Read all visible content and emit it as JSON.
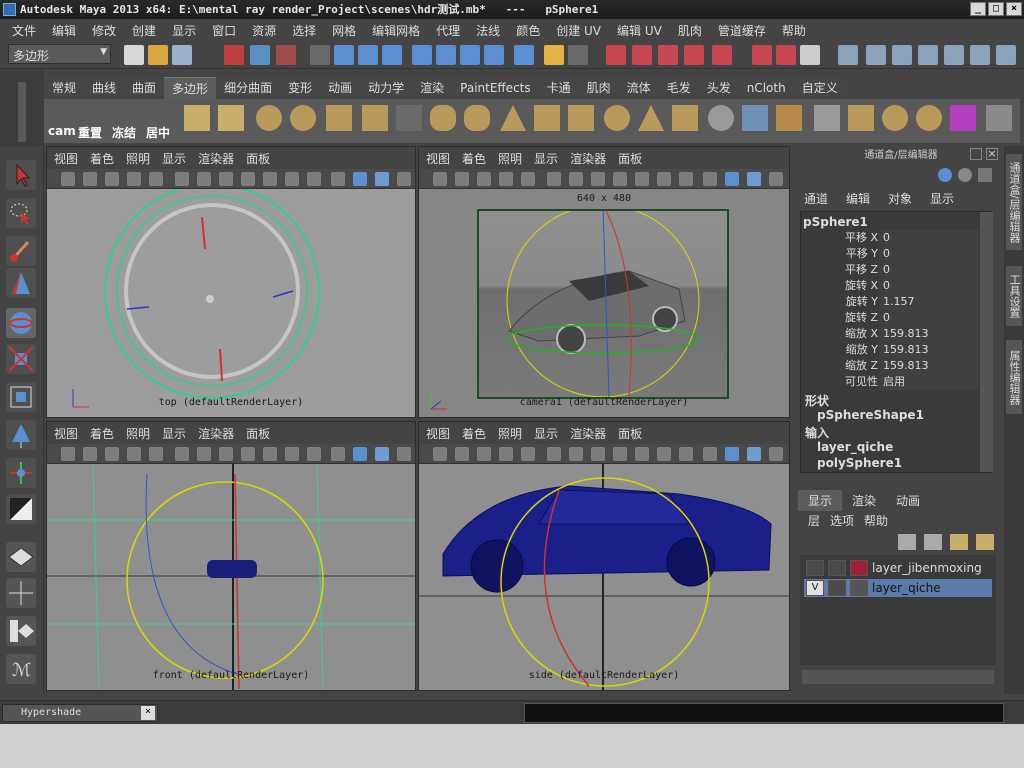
{
  "window": {
    "title": "Autodesk Maya 2013 x64: E:\\mental ray render_Project\\scenes\\hdr测试.mb*   ---   pSphere1",
    "min": "_",
    "max": "□",
    "close": "×"
  },
  "menubar": [
    "文件",
    "编辑",
    "修改",
    "创建",
    "显示",
    "窗口",
    "资源",
    "选择",
    "网格",
    "编辑网格",
    "代理",
    "法线",
    "颜色",
    "创建 UV",
    "编辑 UV",
    "肌肉",
    "管道缓存",
    "帮助"
  ],
  "mode_selector": {
    "value": "多边形",
    "arrow": "▼"
  },
  "shelf": {
    "tabs": [
      "常规",
      "曲线",
      "曲面",
      "多边形",
      "细分曲面",
      "变形",
      "动画",
      "动力学",
      "渲染",
      "PaintEffects",
      "卡通",
      "肌肉",
      "流体",
      "毛发",
      "头发",
      "nCloth",
      "自定义"
    ],
    "active": "多边形",
    "labels": [
      "cam",
      "重置",
      "冻结",
      "居中"
    ]
  },
  "viewport_menu": [
    "视图",
    "着色",
    "照明",
    "显示",
    "渲染器",
    "面板"
  ],
  "viewports": {
    "top": {
      "label": "top (defaultRenderLayer)"
    },
    "persp": {
      "label": "camera1 (defaultRenderLayer)",
      "resolution": "640 x 480"
    },
    "front": {
      "label": "front (defaultRenderLayer)"
    },
    "side": {
      "label": "side (defaultRenderLayer)"
    }
  },
  "channel_box": {
    "header": "通道盒/层编辑器",
    "menu": [
      "通道",
      "编辑",
      "对象",
      "显示"
    ],
    "object": "pSphere1",
    "channels": [
      {
        "name": "平移 X",
        "value": "0"
      },
      {
        "name": "平移 Y",
        "value": "0"
      },
      {
        "name": "平移 Z",
        "value": "0"
      },
      {
        "name": "旋转 X",
        "value": "0"
      },
      {
        "name": "旋转 Y",
        "value": "1.157"
      },
      {
        "name": "旋转 Z",
        "value": "0"
      },
      {
        "name": "缩放 X",
        "value": "159.813"
      },
      {
        "name": "缩放 Y",
        "value": "159.813"
      },
      {
        "name": "缩放 Z",
        "value": "159.813"
      },
      {
        "name": "可见性",
        "value": "启用"
      }
    ],
    "shape_title": "形状",
    "shape": "pSphereShape1",
    "input_title": "输入",
    "inputs": [
      "layer_qiche",
      "polySphere1"
    ]
  },
  "side_tabs": [
    "通道盒/层编辑器",
    "工具设置",
    "属性编辑器"
  ],
  "layer_editor": {
    "tabs": [
      "显示",
      "渲染",
      "动画"
    ],
    "menu": [
      "层",
      "选项",
      "帮助"
    ],
    "layers": [
      {
        "name": "layer_jibenmoxing",
        "visible": "",
        "color": "#a0203a"
      },
      {
        "name": "layer_qiche",
        "visible": "V",
        "color": "#555555"
      }
    ]
  },
  "bottom": {
    "hypershade": "Hypershade",
    "close": "×"
  }
}
